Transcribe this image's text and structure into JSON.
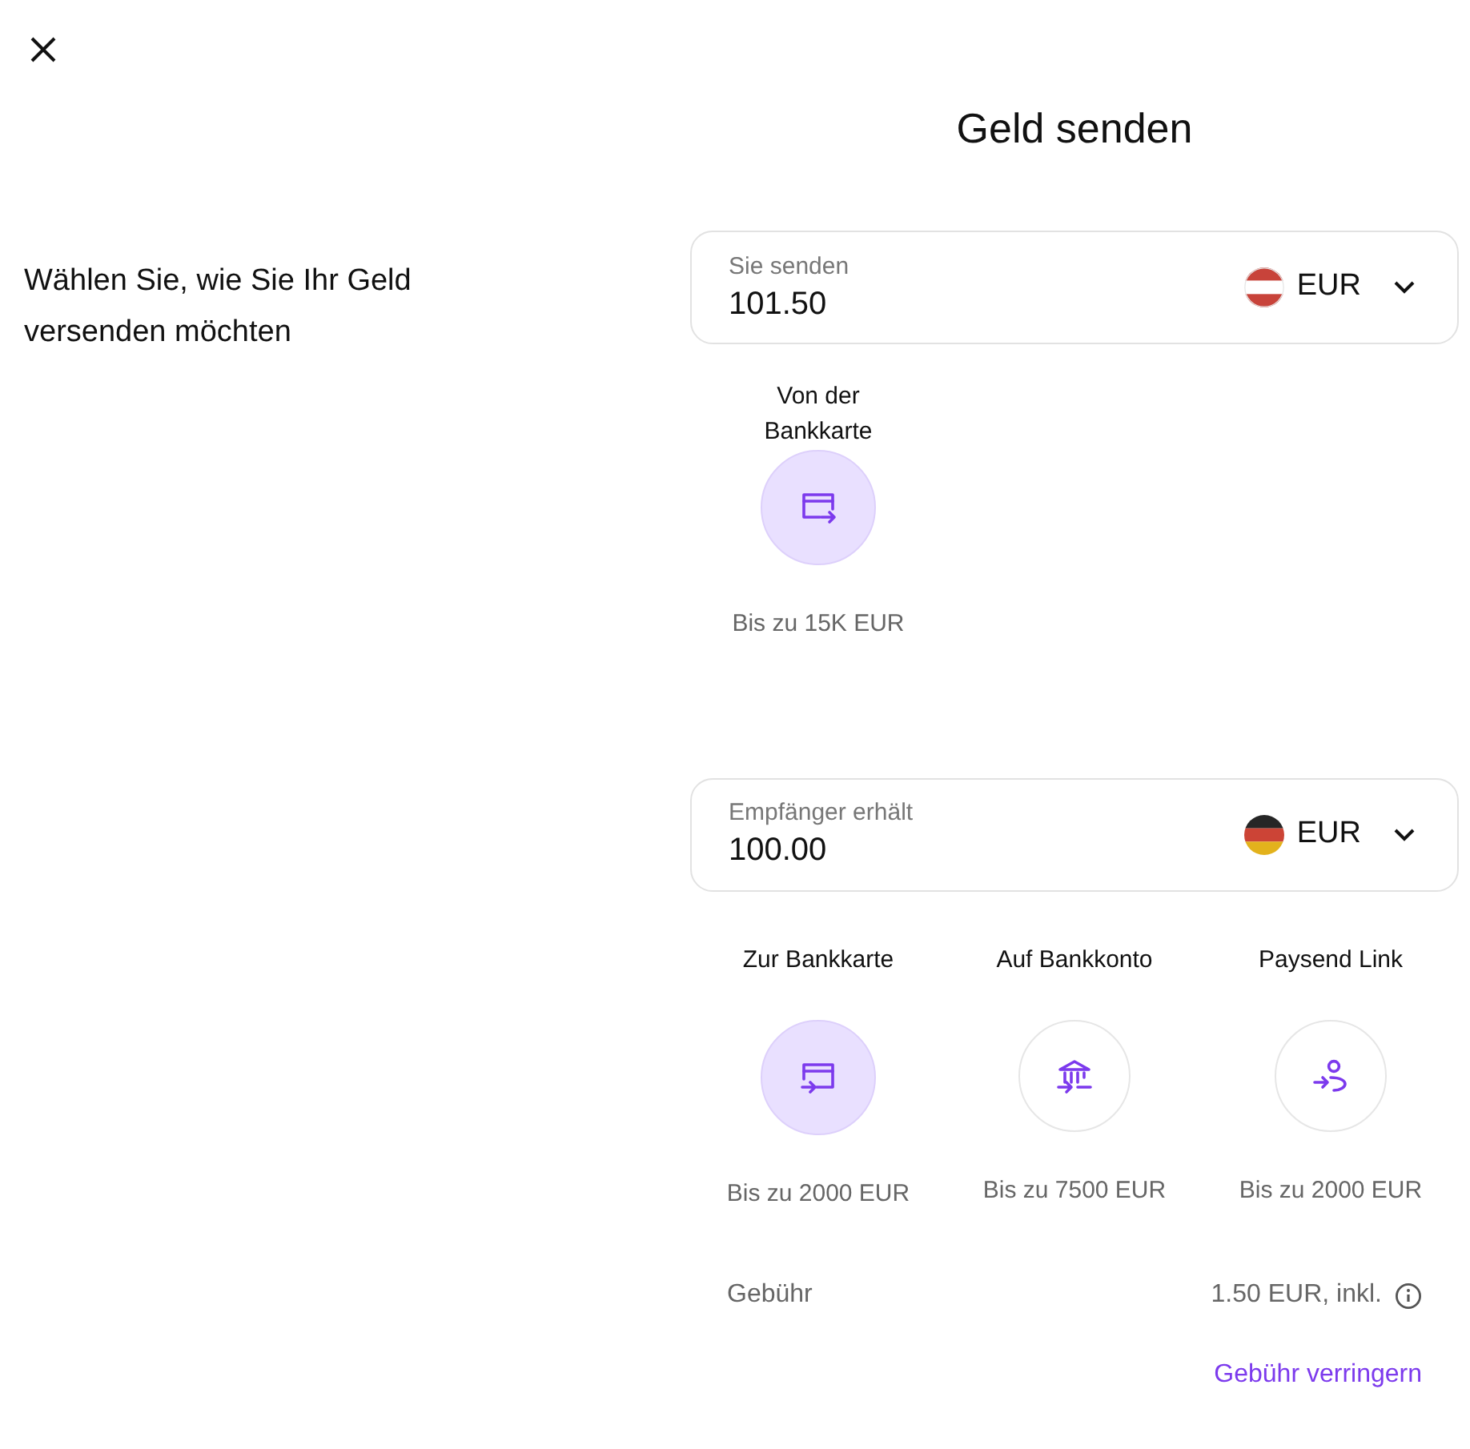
{
  "title": "Geld senden",
  "intro": "Wählen Sie, wie Sie Ihr Geld versenden möchten",
  "sections": [
    {
      "field": {
        "label": "Sie senden",
        "value": "101.50",
        "currency": "EUR"
      },
      "methods": [
        {
          "label": "Von der Bankkarte",
          "limit": "Bis zu 15K EUR",
          "selected": true
        }
      ]
    },
    {
      "field": {
        "label": "Empfänger erhält",
        "value": "100.00",
        "currency": "EUR"
      },
      "methods": [
        {
          "label": "Zur Bankkarte",
          "limit": "Bis zu 2000 EUR",
          "selected": true
        },
        {
          "label": "Auf Bankkonto",
          "limit": "Bis zu 7500 EUR",
          "selected": false
        },
        {
          "label": "Paysend Link",
          "limit": "Bis zu 2000 EUR",
          "selected": false
        }
      ]
    }
  ],
  "fee": {
    "label": "Gebühr",
    "value": "1.50 EUR, inkl."
  },
  "link": "Gebühr verringern"
}
